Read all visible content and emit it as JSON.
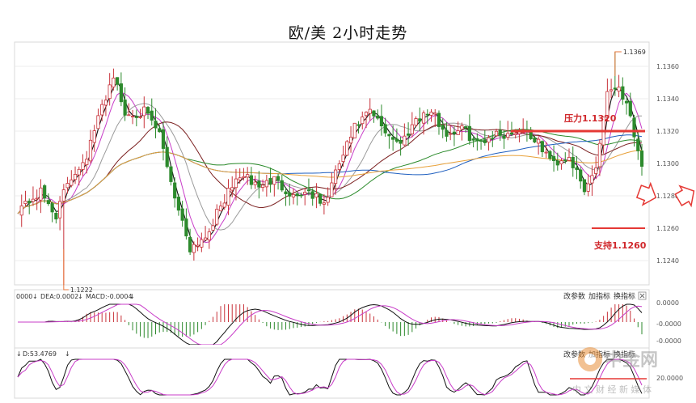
{
  "chart_data": {
    "type": "candlestick",
    "title": "欧/美 2小时走势",
    "y_ticks": [
      "1.1360",
      "1.1340",
      "1.1320",
      "1.1300",
      "1.1280",
      "1.1260",
      "1.1240"
    ],
    "ylim": [
      1.1225,
      1.1375
    ],
    "annotations": {
      "high": "1.1369",
      "low": "1.1222",
      "resistance_label": "压力1.1320",
      "resistance_value": 1.132,
      "support_label": "支持1.1260",
      "support_value": 1.126
    },
    "macd_panel": {
      "dif_label": "0000",
      "dea_label": "DEA:0.0002",
      "macd_label": "MACD:-0.0004",
      "ticks": [
        "0.0000",
        "-0.0000",
        "-0.0000"
      ],
      "tools": [
        "改参数",
        "加指标",
        "换指标"
      ]
    },
    "kdj_panel": {
      "d_label": "D:53.4769",
      "tick": "20.0000",
      "tools": [
        "改参数",
        "加指标",
        "换指标"
      ]
    },
    "colors": {
      "up": "#c8323a",
      "down": "#2d8a2d",
      "ma_black": "#111111",
      "ma_magenta": "#c83cc8",
      "ma_gray": "#9a9a9a",
      "ma_darkred": "#7a1e1e",
      "ma_green": "#2a8a2a",
      "ma_blue": "#1f5fbf",
      "ma_orange": "#e8a13a",
      "level_line": "#e53935"
    }
  },
  "watermark": {
    "brand": "中金网",
    "tagline": "中 文 财 经 新 媒 体"
  }
}
